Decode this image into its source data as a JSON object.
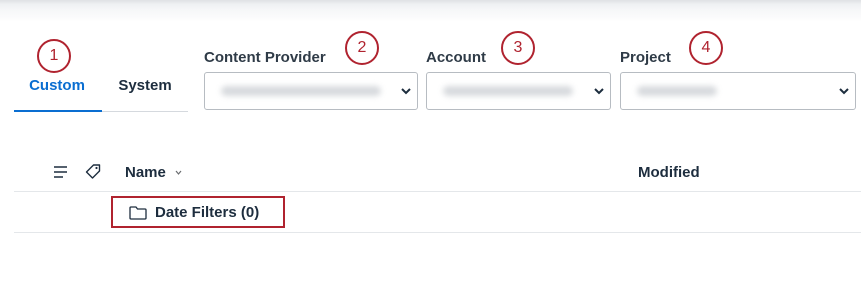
{
  "tabs": [
    {
      "label": "Custom",
      "active": true
    },
    {
      "label": "System",
      "active": false
    }
  ],
  "callouts": [
    "1",
    "2",
    "3",
    "4"
  ],
  "filters": {
    "content_provider": {
      "label": "Content Provider",
      "value": ""
    },
    "account": {
      "label": "Account",
      "value": ""
    },
    "project": {
      "label": "Project",
      "value": ""
    }
  },
  "table": {
    "columns": {
      "name": "Name",
      "modified": "Modified"
    },
    "rows": [
      {
        "name": "Date Filters (0)",
        "modified": ""
      }
    ]
  },
  "icons": {
    "list": "list-icon",
    "tag": "tag-icon",
    "folder": "folder-icon",
    "select_caret": "chevron-down-icon",
    "sort": "sort-caret-icon"
  },
  "colors": {
    "accent": "#0a6ed1",
    "callout": "#b0232f",
    "text": "#1d2d3e"
  }
}
